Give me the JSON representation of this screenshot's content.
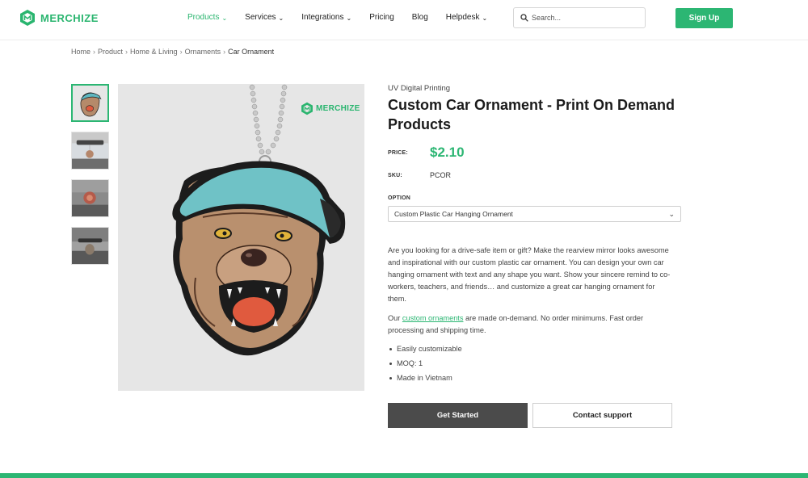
{
  "brand": {
    "name": "MERCHIZE",
    "accent": "#2cb673"
  },
  "nav": {
    "items": [
      {
        "label": "Products",
        "dropdown": true,
        "active": true
      },
      {
        "label": "Services",
        "dropdown": true
      },
      {
        "label": "Integrations",
        "dropdown": true
      },
      {
        "label": "Pricing",
        "dropdown": false
      },
      {
        "label": "Blog",
        "dropdown": false
      },
      {
        "label": "Helpdesk",
        "dropdown": true
      }
    ]
  },
  "search": {
    "placeholder": "Search...",
    "icon": "search-icon"
  },
  "signup": {
    "label": "Sign Up"
  },
  "breadcrumb": [
    "Home",
    "Product",
    "Home & Living",
    "Ornaments",
    "Car Ornament"
  ],
  "gallery": {
    "thumb_count": 4,
    "active_index": 0,
    "watermark": "MERCHIZE"
  },
  "product": {
    "category": "UV Digital Printing",
    "title": "Custom Car Ornament - Print On Demand Products",
    "price_label": "PRICE:",
    "price": "$2.10",
    "sku_label": "SKU:",
    "sku": "PCOR",
    "option_label": "OPTION",
    "option_selected": "Custom Plastic Car Hanging Ornament",
    "description": "Are you looking for a drive-safe item or gift? Make the rearview mirror looks awesome and inspirational with our custom plastic car ornament. You can design your own car hanging ornament with text and any shape you want. Show your sincere remind to co-workers, teachers, and friends… and customize a great car hanging ornament for them.",
    "note_prefix": "Our ",
    "note_link": "custom ornaments",
    "note_suffix": " are made on-demand. No order minimums. Fast order processing and shipping time.",
    "features": [
      "Easily customizable",
      "MOQ: 1",
      "Made in Vietnam"
    ]
  },
  "actions": {
    "primary": "Get Started",
    "secondary": "Contact support"
  }
}
